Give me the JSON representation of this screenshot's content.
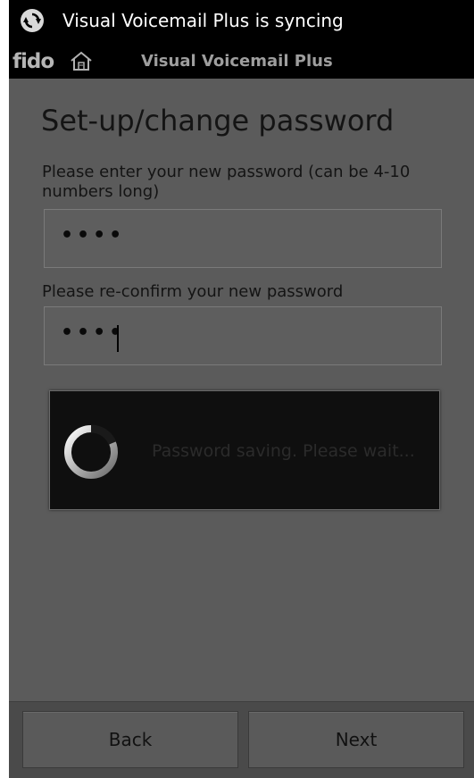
{
  "status_bar": {
    "notification_text": "Visual Voicemail Plus is syncing",
    "icon": "sync-icon"
  },
  "title_bar": {
    "logo_text": "fido",
    "home_icon": "home-icon",
    "app_title": "Visual Voicemail Plus"
  },
  "form": {
    "page_title": "Set-up/change password",
    "new_password_label": "Please enter your new password (can be 4-10 numbers long)",
    "new_password_value": "••••",
    "confirm_password_label": "Please re-confirm your new password",
    "confirm_password_value": "••••"
  },
  "progress_dialog": {
    "message": "Password saving. Please wait...",
    "icon": "spinner-icon"
  },
  "bottom_bar": {
    "back_label": "Back",
    "next_label": "Next"
  },
  "colors": {
    "background": "#5b5b5b",
    "bars": "#000000",
    "dialog": "#0f0f0f",
    "text": "#141414"
  }
}
